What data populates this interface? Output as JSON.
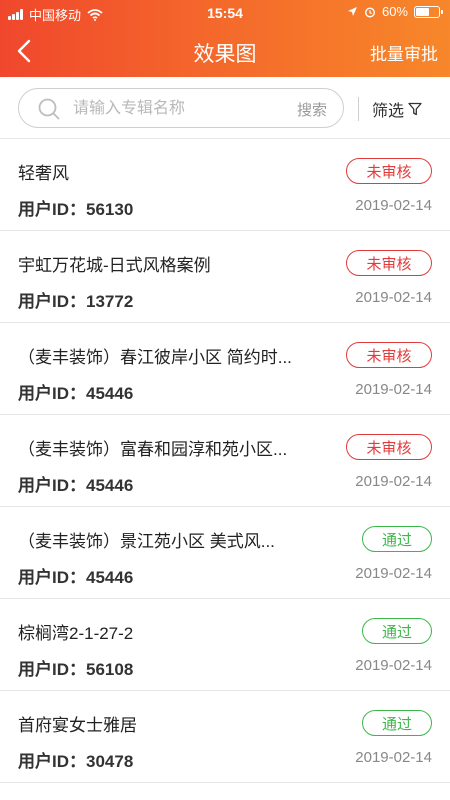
{
  "status_bar": {
    "carrier": "中国移动",
    "time": "15:54",
    "battery": "60%",
    "battery_level": 0.6
  },
  "header": {
    "title": "效果图",
    "batch_approve_label": "批量审批"
  },
  "search": {
    "placeholder": "请输入专辑名称",
    "button_label": "搜索"
  },
  "filter": {
    "label": "筛选"
  },
  "colors": {
    "accent_start": "#f0472c",
    "accent_end": "#f7872a",
    "pending": "#e23b3b",
    "passed": "#3cb84a"
  },
  "items": [
    {
      "title": "轻奢风",
      "user": "用户ID：56130",
      "date": "2019-02-14",
      "status": "未审核",
      "status_type": "pending"
    },
    {
      "title": "宇虹万花城-日式风格案例",
      "user": "用户ID：13772",
      "date": "2019-02-14",
      "status": "未审核",
      "status_type": "pending"
    },
    {
      "title": "（麦丰装饰）春江彼岸小区 简约时...",
      "user": "用户ID：45446",
      "date": "2019-02-14",
      "status": "未审核",
      "status_type": "pending"
    },
    {
      "title": "（麦丰装饰）富春和园淳和苑小区...",
      "user": "用户ID：45446",
      "date": "2019-02-14",
      "status": "未审核",
      "status_type": "pending"
    },
    {
      "title": "（麦丰装饰）景江苑小区 美式风...",
      "user": "用户ID：45446",
      "date": "2019-02-14",
      "status": "通过",
      "status_type": "passed"
    },
    {
      "title": "棕榈湾2-1-27-2",
      "user": "用户ID：56108",
      "date": "2019-02-14",
      "status": "通过",
      "status_type": "passed"
    },
    {
      "title": "首府宴女士雅居",
      "user": "用户ID：30478",
      "date": "2019-02-14",
      "status": "通过",
      "status_type": "passed"
    }
  ]
}
